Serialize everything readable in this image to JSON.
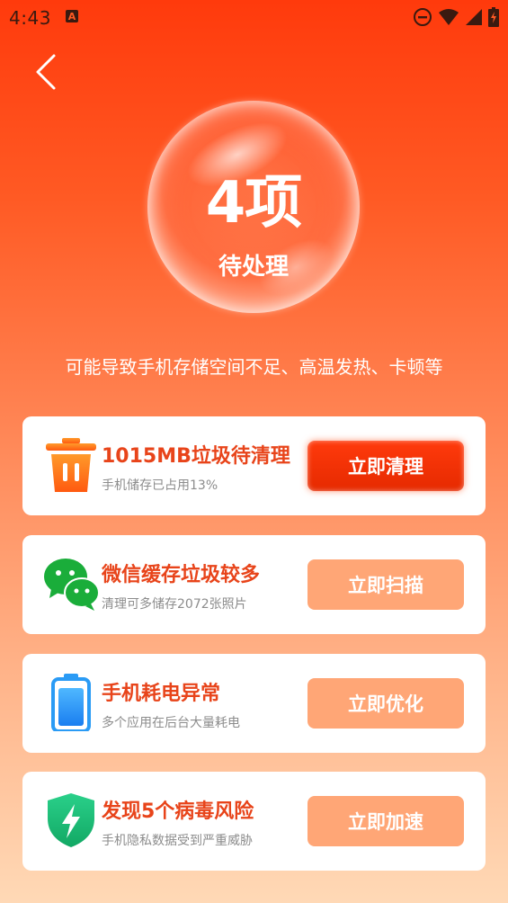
{
  "status": {
    "time": "4:43",
    "app_badge": "A"
  },
  "hero": {
    "count": "4项",
    "label": "待处理"
  },
  "subtitle": "可能导致手机存储空间不足、高温发热、卡顿等",
  "cards": [
    {
      "icon": "trash-icon",
      "title": "1015MB垃圾待清理",
      "desc": "手机储存已占用13%",
      "button": "立即清理"
    },
    {
      "icon": "wechat-icon",
      "title": "微信缓存垃圾较多",
      "desc": "清理可多储存2072张照片",
      "button": "立即扫描"
    },
    {
      "icon": "battery-icon",
      "title": "手机耗电异常",
      "desc": "多个应用在后台大量耗电",
      "button": "立即优化"
    },
    {
      "icon": "shield-bolt-icon",
      "title": "发现5个病毒风险",
      "desc": "手机隐私数据受到严重威胁",
      "button": "立即加速"
    }
  ],
  "colors": {
    "accent": "#e8441a",
    "button_secondary": "#ffa676",
    "button_primary": "#ff3a0c"
  }
}
